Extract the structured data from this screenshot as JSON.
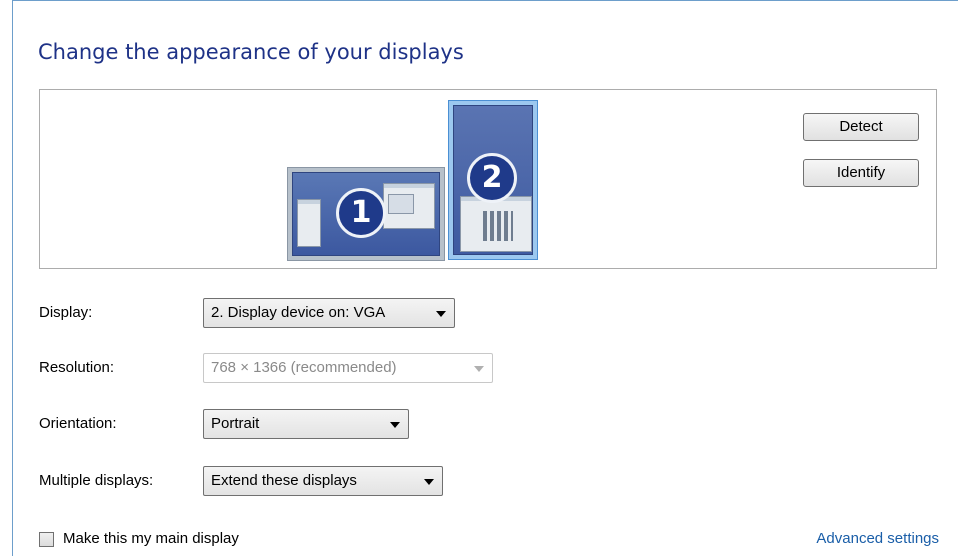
{
  "page": {
    "title": "Change the appearance of your displays"
  },
  "preview": {
    "monitor1": {
      "number": "1"
    },
    "monitor2": {
      "number": "2"
    },
    "detect_label": "Detect",
    "identify_label": "Identify"
  },
  "settings": {
    "display": {
      "label": "Display:",
      "value": "2. Display device on: VGA"
    },
    "resolution": {
      "label": "Resolution:",
      "value": "768 × 1366 (recommended)"
    },
    "orientation": {
      "label": "Orientation:",
      "value": "Portrait"
    },
    "multiple": {
      "label": "Multiple displays:",
      "value": "Extend these displays"
    }
  },
  "footer": {
    "main_display_label": "Make this my main display",
    "advanced_link": "Advanced settings"
  },
  "colors": {
    "title": "#1e3287",
    "link": "#1a5ea8",
    "selected_monitor_border": "#4b8fd3"
  }
}
